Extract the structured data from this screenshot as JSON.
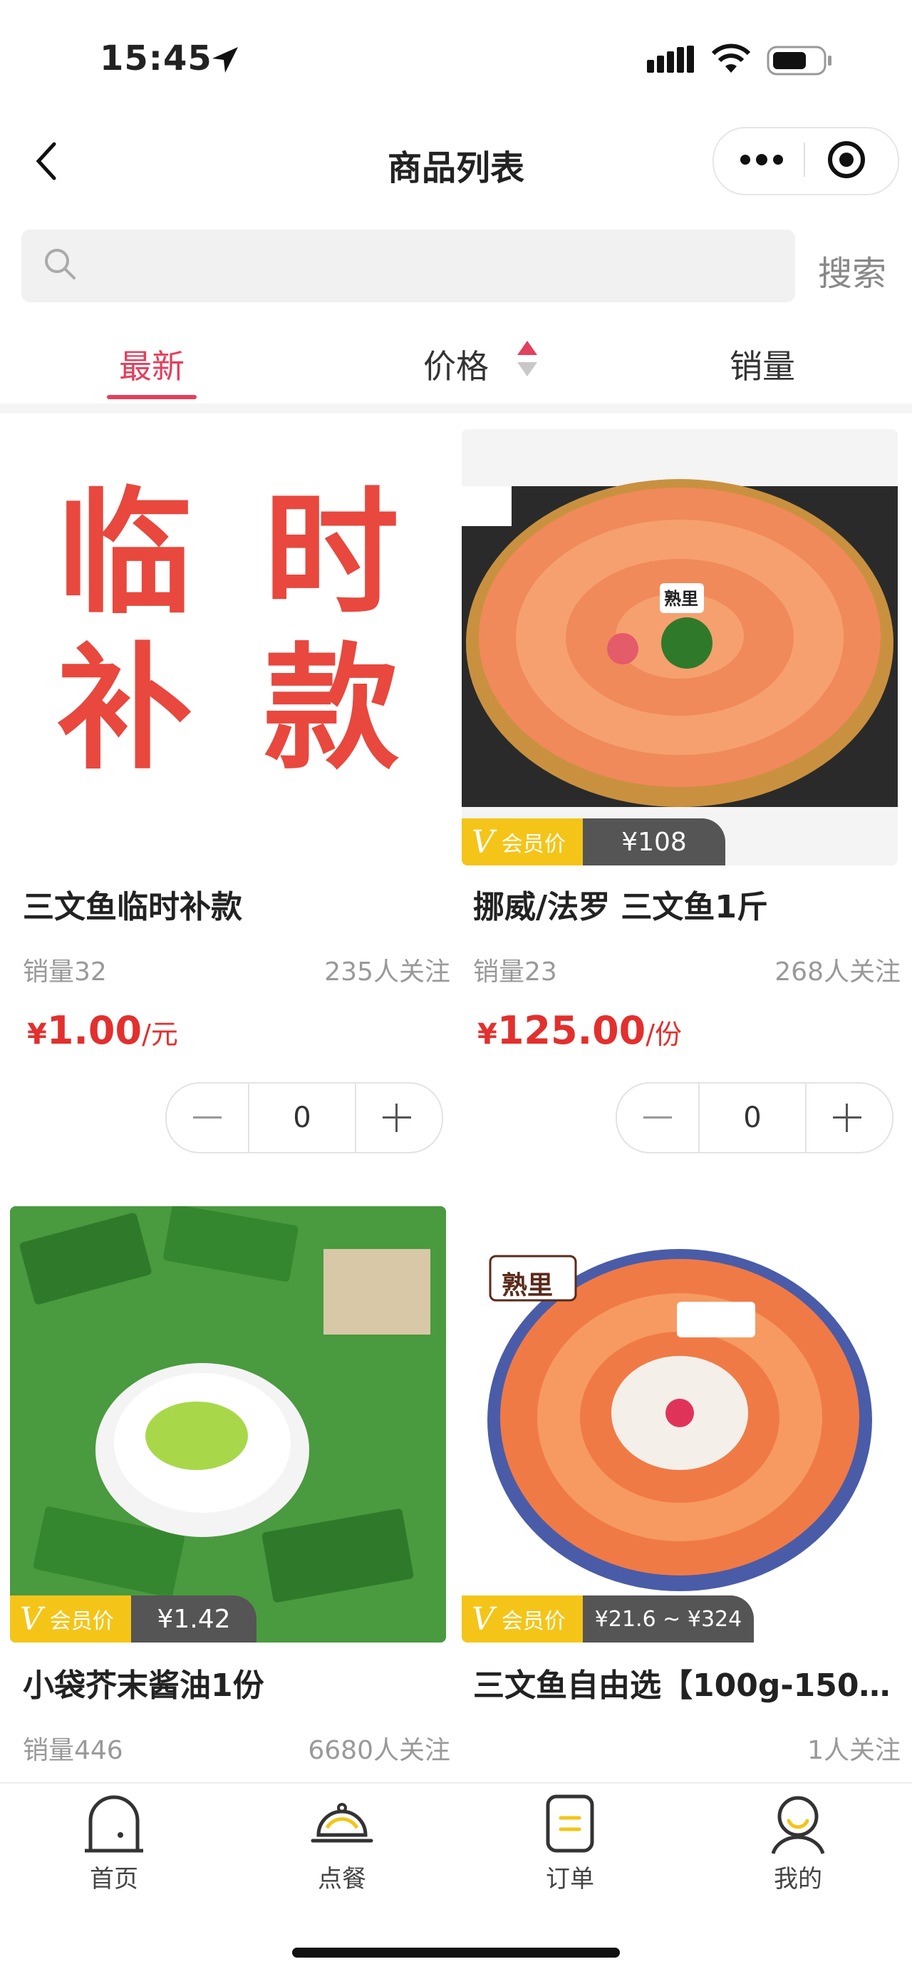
{
  "status": {
    "time": "15:45"
  },
  "nav": {
    "title": "商品列表"
  },
  "search": {
    "placeholder": "",
    "button": "搜索"
  },
  "tabs": {
    "newest": "最新",
    "price": "价格",
    "sales": "销量"
  },
  "colors": {
    "accent": "#e2405e",
    "price": "#e2302e",
    "member_badge": "#f4c518"
  },
  "products": [
    {
      "name": "三文鱼临时补款",
      "sales": "销量32",
      "follow": "235人关注",
      "yen": "¥",
      "price": "1.00",
      "unit": "/元",
      "qty": "0",
      "image_text": [
        "临",
        "时",
        "补",
        "款"
      ]
    },
    {
      "name": "挪威/法罗 三文鱼1斤",
      "sales": "销量23",
      "follow": "268人关注",
      "yen": "¥",
      "price": "125.00",
      "unit": "/份",
      "qty": "0",
      "badge_v": "V",
      "badge_label": "会员价",
      "member_price": "¥108",
      "logo_text": "熟里"
    },
    {
      "name": "小袋芥末酱油1份",
      "sales": "销量446",
      "follow": "6680人关注",
      "badge_v": "V",
      "badge_label": "会员价",
      "member_price": "¥1.42"
    },
    {
      "name": "三文鱼自由选【100g-150…",
      "sales": "",
      "follow": "1人关注",
      "badge_v": "V",
      "badge_label": "会员价",
      "member_price": "¥21.6 ~ ¥324",
      "logo_text": "熟里"
    }
  ],
  "tabbar": [
    {
      "label": "首页",
      "icon": "home-icon"
    },
    {
      "label": "点餐",
      "icon": "cloche-icon"
    },
    {
      "label": "订单",
      "icon": "order-icon"
    },
    {
      "label": "我的",
      "icon": "user-icon"
    }
  ]
}
